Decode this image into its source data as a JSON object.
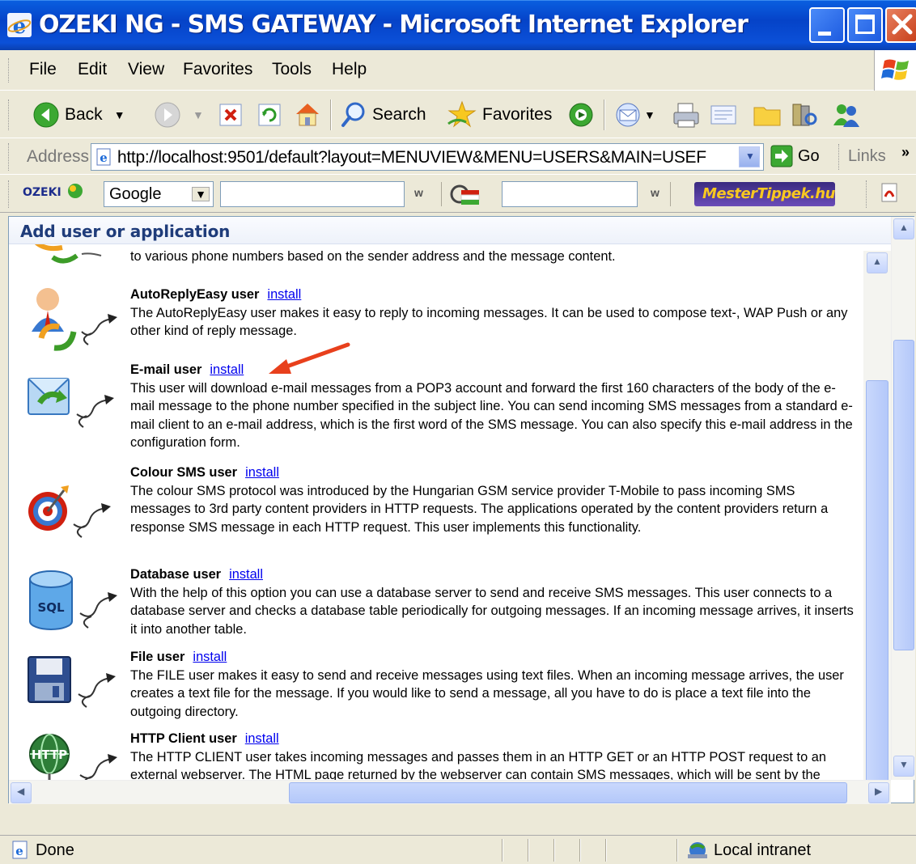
{
  "window": {
    "title": "OZEKI NG - SMS GATEWAY - Microsoft Internet Explorer"
  },
  "menu": [
    "File",
    "Edit",
    "View",
    "Favorites",
    "Tools",
    "Help"
  ],
  "toolbar": {
    "back": "Back",
    "search": "Search",
    "favorites": "Favorites"
  },
  "address": {
    "label": "Address",
    "url": "http://localhost:9501/default?layout=MENUVIEW&MENU=USERS&MAIN=USEF",
    "go": "Go",
    "links": "Links"
  },
  "googlebar": {
    "brand": "OZEKI",
    "engine": "Google",
    "mestertippek": "MesterTippek.hu"
  },
  "section": {
    "title": "Add user or application"
  },
  "entries": {
    "partial": "to various phone numbers based on the sender address and the message content.",
    "autoreply": {
      "name": "AutoReplyEasy user",
      "link": "install",
      "desc": "The AutoReplyEasy user makes it easy to reply to incoming messages. It can be used to compose text-, WAP Push or any other kind of reply message."
    },
    "email": {
      "name": "E-mail user",
      "link": "install",
      "desc": "This user will download e-mail messages from a POP3 account and forward the first 160 characters of the body of the e-mail message to the phone number specified in the subject line. You can send incoming SMS messages from a standard e-mail client to an e-mail address, which is the first word of the SMS message. You can also specify this e-mail address in the configuration form."
    },
    "colour": {
      "name": "Colour SMS user",
      "link": "install",
      "desc": "The colour SMS protocol was introduced by the Hungarian GSM service provider T-Mobile to pass incoming SMS messages to 3rd party content providers in HTTP requests. The applications operated by the content providers return a response SMS message in each HTTP request. This user implements this functionality."
    },
    "database": {
      "name": "Database user",
      "link": "install",
      "icon_text": "SQL",
      "desc": "With the help of this option you can use a database server to send and receive SMS messages. This user connects to a database server and checks a database table periodically for outgoing messages. If an incoming message arrives, it inserts it into another table."
    },
    "file": {
      "name": "File user",
      "link": "install",
      "desc": "The FILE user makes it easy to send and receive messages using text files. When an incoming message arrives, the user creates a text file for the message. If you would like to send a message, all you have to do is place a text file into the outgoing directory."
    },
    "http": {
      "name": "HTTP Client user",
      "link": "install",
      "icon_text": "HTTP",
      "desc": "The HTTP CLIENT user takes incoming messages and passes them in an HTTP GET or an HTTP POST request to an external webserver. The HTML page returned by the webserver can contain SMS messages, which will be sent by the server."
    }
  },
  "status": {
    "text": "Done",
    "zone": "Local intranet"
  },
  "colors": {
    "title_blue": "#0543C8",
    "link": "#0000EE",
    "arrow": "#E8401C",
    "header_text": "#1F3C7A"
  },
  "icons": [
    "ie-icon",
    "back-icon",
    "forward-icon",
    "stop-icon",
    "refresh-icon",
    "home-icon",
    "search-icon",
    "favorites-star-icon",
    "media-icon",
    "mail-icon",
    "print-icon",
    "edit-icon",
    "folder-icon",
    "research-icon",
    "messenger-icon",
    "page-icon",
    "go-arrow-icon",
    "globe-icon"
  ]
}
